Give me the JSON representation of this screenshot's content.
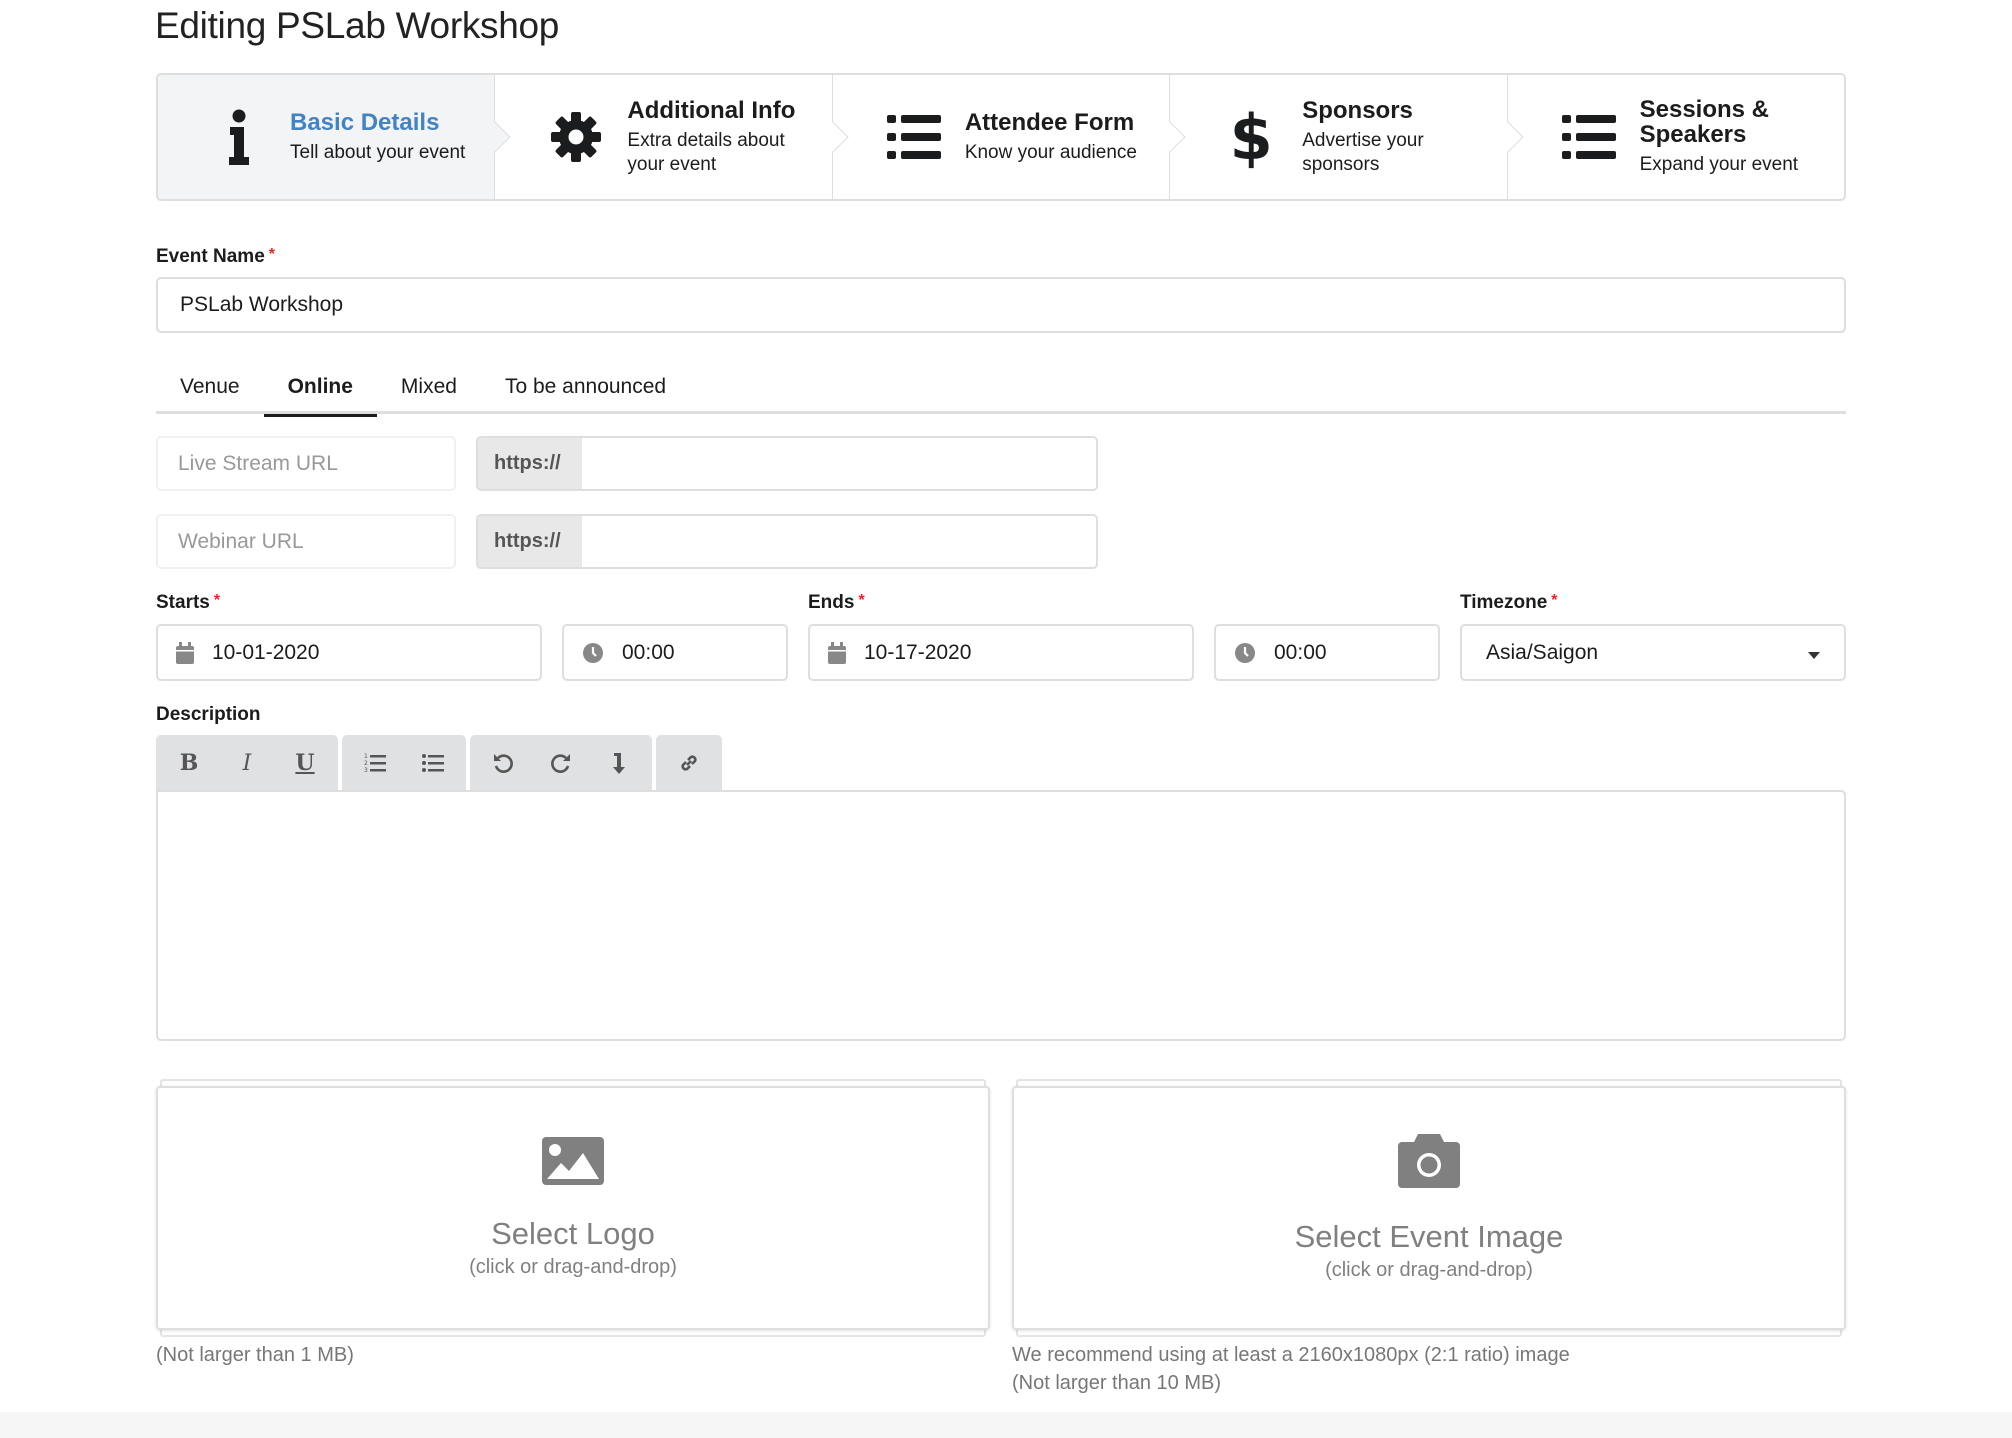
{
  "page": {
    "title": "Editing PSLab Workshop"
  },
  "stepper": {
    "steps": [
      {
        "icon": "info-icon",
        "title": "Basic Details",
        "desc": "Tell about your event",
        "active": true
      },
      {
        "icon": "gear-icon",
        "title": "Additional Info",
        "desc": "Extra details about your event",
        "active": false
      },
      {
        "icon": "list-icon",
        "title": "Attendee Form",
        "desc": "Know your audience",
        "active": false
      },
      {
        "icon": "dollar-icon",
        "title": "Sponsors",
        "desc": "Advertise your sponsors",
        "active": false
      },
      {
        "icon": "list-icon",
        "title": "Sessions & Speakers",
        "desc": "Expand your event",
        "active": false
      }
    ]
  },
  "event_name": {
    "label": "Event Name",
    "required_mark": "*",
    "value": "PSLab Workshop"
  },
  "location_tabs": {
    "items": [
      "Venue",
      "Online",
      "Mixed",
      "To be announced"
    ],
    "active": "Online"
  },
  "online": {
    "live_stream": {
      "label": "Live Stream URL",
      "prefix": "https://",
      "value": ""
    },
    "webinar": {
      "label": "Webinar URL",
      "prefix": "https://",
      "value": ""
    }
  },
  "schedule": {
    "starts": {
      "label": "Starts",
      "required_mark": "*",
      "date": "10-01-2020",
      "time": "00:00"
    },
    "ends": {
      "label": "Ends",
      "required_mark": "*",
      "date": "10-17-2020",
      "time": "00:00"
    },
    "timezone": {
      "label": "Timezone",
      "required_mark": "*",
      "value": "Asia/Saigon"
    }
  },
  "description": {
    "label": "Description",
    "toolbar": {
      "bold": "B",
      "italic": "I",
      "underline": "U"
    },
    "value": ""
  },
  "uploads": {
    "logo": {
      "title": "Select Logo",
      "sub": "(click or drag-and-drop)",
      "notes": [
        "(Not larger than 1 MB)"
      ]
    },
    "image": {
      "title": "Select Event Image",
      "sub": "(click or drag-and-drop)",
      "notes": [
        "We recommend using at least a 2160x1080px (2:1 ratio) image",
        "(Not larger than 10 MB)"
      ]
    }
  },
  "colors": {
    "accent": "#4183c4",
    "required": "#db2828",
    "border": "#dededf",
    "active_step_bg": "#f3f4f5"
  }
}
